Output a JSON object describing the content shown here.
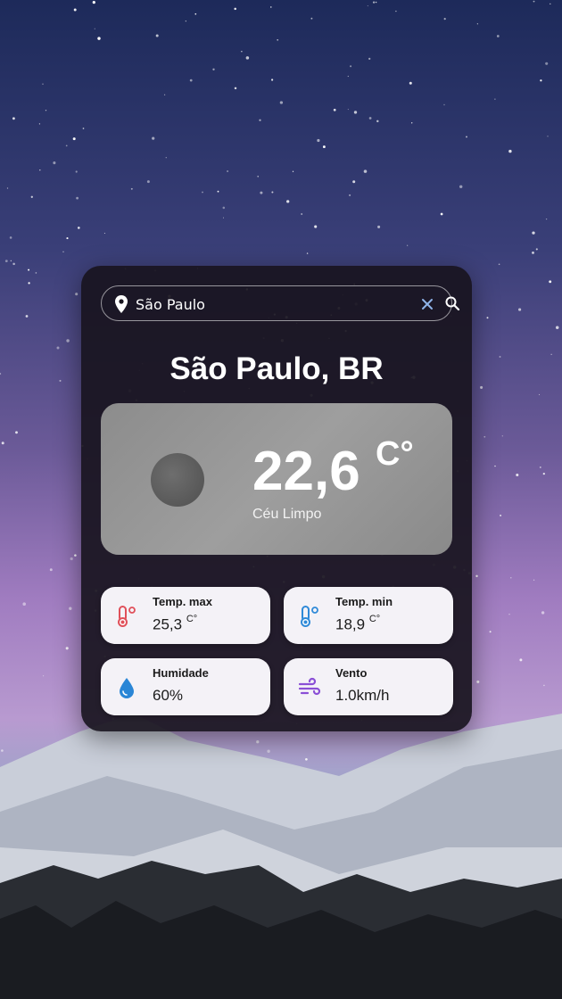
{
  "search": {
    "value": "São Paulo",
    "icons": {
      "pin": "map-pin-icon",
      "clear": "close-icon",
      "submit": "search-icon"
    }
  },
  "city": "São Paulo, BR",
  "current": {
    "temperature": "22,6",
    "unit": "C°",
    "description": "Céu Limpo",
    "icon": "weather-condition-icon"
  },
  "stats": {
    "max": {
      "label": "Temp. max",
      "value": "25,3",
      "unit": "C°",
      "icon": "thermometer-hot-icon",
      "color": "#e0505a"
    },
    "min": {
      "label": "Temp. min",
      "value": "18,9",
      "unit": "C°",
      "icon": "thermometer-cold-icon",
      "color": "#2f8ad8"
    },
    "humidity": {
      "label": "Humidade",
      "value": "60%",
      "icon": "water-drop-icon",
      "color": "#2a86d6"
    },
    "wind": {
      "label": "Vento",
      "value": "1.0km/h",
      "icon": "wind-icon",
      "color": "#8a4fd6"
    }
  },
  "colors": {
    "card": "#18141e",
    "panel": "#9a9a9a",
    "stat_card": "#f4f2f7",
    "text": "#ffffff"
  }
}
